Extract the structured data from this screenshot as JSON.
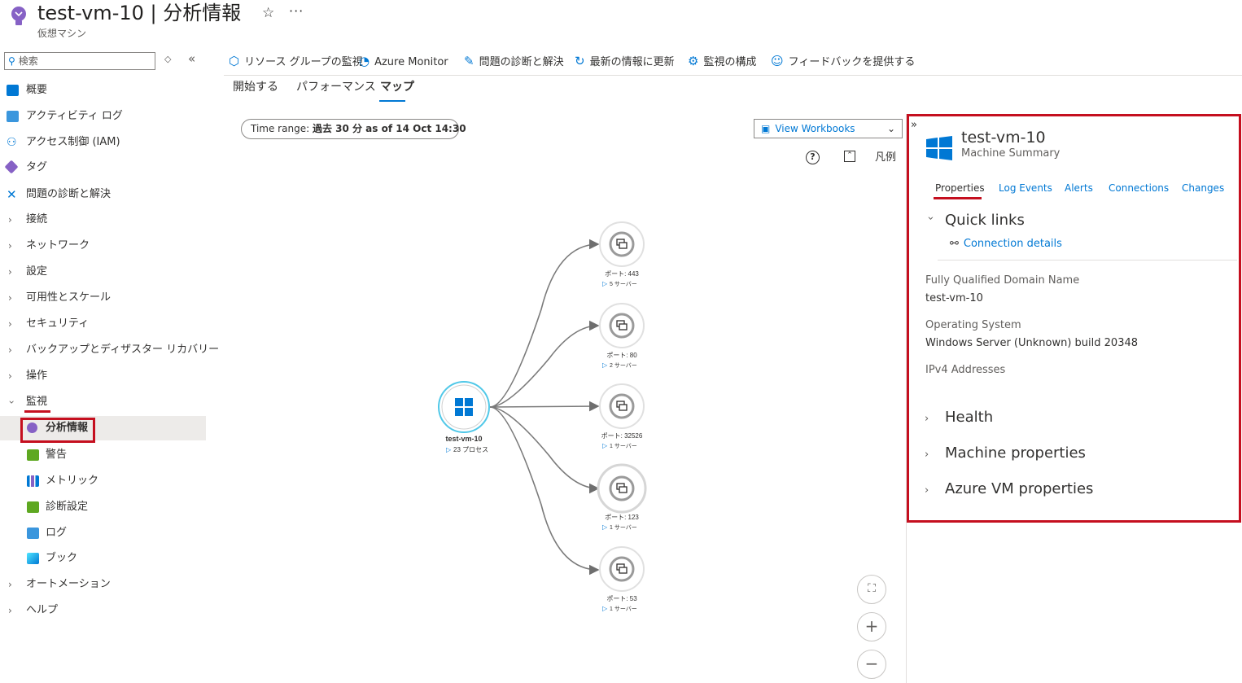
{
  "header": {
    "title": "test-vm-10 | 分析情報",
    "subtitle": "仮想マシン",
    "more": "···"
  },
  "sidebar": {
    "search_placeholder": "検索",
    "items": [
      {
        "label": "概要"
      },
      {
        "label": "アクティビティ ログ"
      },
      {
        "label": "アクセス制御 (IAM)"
      },
      {
        "label": "タグ"
      },
      {
        "label": "問題の診断と解決"
      },
      {
        "label": "接続"
      },
      {
        "label": "ネットワーク"
      },
      {
        "label": "設定"
      },
      {
        "label": "可用性とスケール"
      },
      {
        "label": "セキュリティ"
      },
      {
        "label": "バックアップとディザスター リカバリー"
      },
      {
        "label": "操作"
      },
      {
        "label": "監視"
      },
      {
        "label": "分析情報"
      },
      {
        "label": "警告"
      },
      {
        "label": "メトリック"
      },
      {
        "label": "診断設定"
      },
      {
        "label": "ログ"
      },
      {
        "label": "ブック"
      },
      {
        "label": "オートメーション"
      },
      {
        "label": "ヘルプ"
      }
    ]
  },
  "toolbar": {
    "items": [
      {
        "label": "リソース グループの監視"
      },
      {
        "label": "Azure Monitor"
      },
      {
        "label": "問題の診断と解決"
      },
      {
        "label": "最新の情報に更新"
      },
      {
        "label": "監視の構成"
      },
      {
        "label": "フィードバックを提供する"
      }
    ]
  },
  "tabs": [
    {
      "label": "開始する"
    },
    {
      "label": "パフォーマンス"
    },
    {
      "label": "マップ"
    }
  ],
  "map": {
    "time_range_label": "Time range:",
    "time_range_value": "過去 30 分 as of 14 Oct 14:30",
    "view_workbooks": "View Workbooks",
    "legend": "凡例",
    "machine": {
      "name": "test-vm-10",
      "process_count": "23 プロセス"
    },
    "ports": [
      {
        "port": "ポート: 443",
        "servers": "5 サーバー"
      },
      {
        "port": "ポート: 80",
        "servers": "2 サーバー"
      },
      {
        "port": "ポート: 32526",
        "servers": "1 サーバー"
      },
      {
        "port": "ポート: 123",
        "servers": "1 サーバー"
      },
      {
        "port": "ポート: 53",
        "servers": "1 サーバー"
      }
    ]
  },
  "panel": {
    "machine_name": "test-vm-10",
    "machine_summary": "Machine Summary",
    "tabs": [
      {
        "label": "Properties"
      },
      {
        "label": "Log Events"
      },
      {
        "label": "Alerts"
      },
      {
        "label": "Connections"
      },
      {
        "label": "Changes"
      }
    ],
    "quick_links_title": "Quick links",
    "connection_details": "Connection details",
    "fqdn_label": "Fully Qualified Domain Name",
    "fqdn_value": "test-vm-10",
    "os_label": "Operating System",
    "os_value": "Windows Server (Unknown) build 20348",
    "ipv4_label": "IPv4 Addresses",
    "sections": [
      {
        "label": "Health"
      },
      {
        "label": "Machine properties"
      },
      {
        "label": "Azure VM properties"
      }
    ]
  },
  "colors": {
    "accent": "#0078d4",
    "highlight": "#c50f1f",
    "selected_bg": "#edebe9"
  }
}
